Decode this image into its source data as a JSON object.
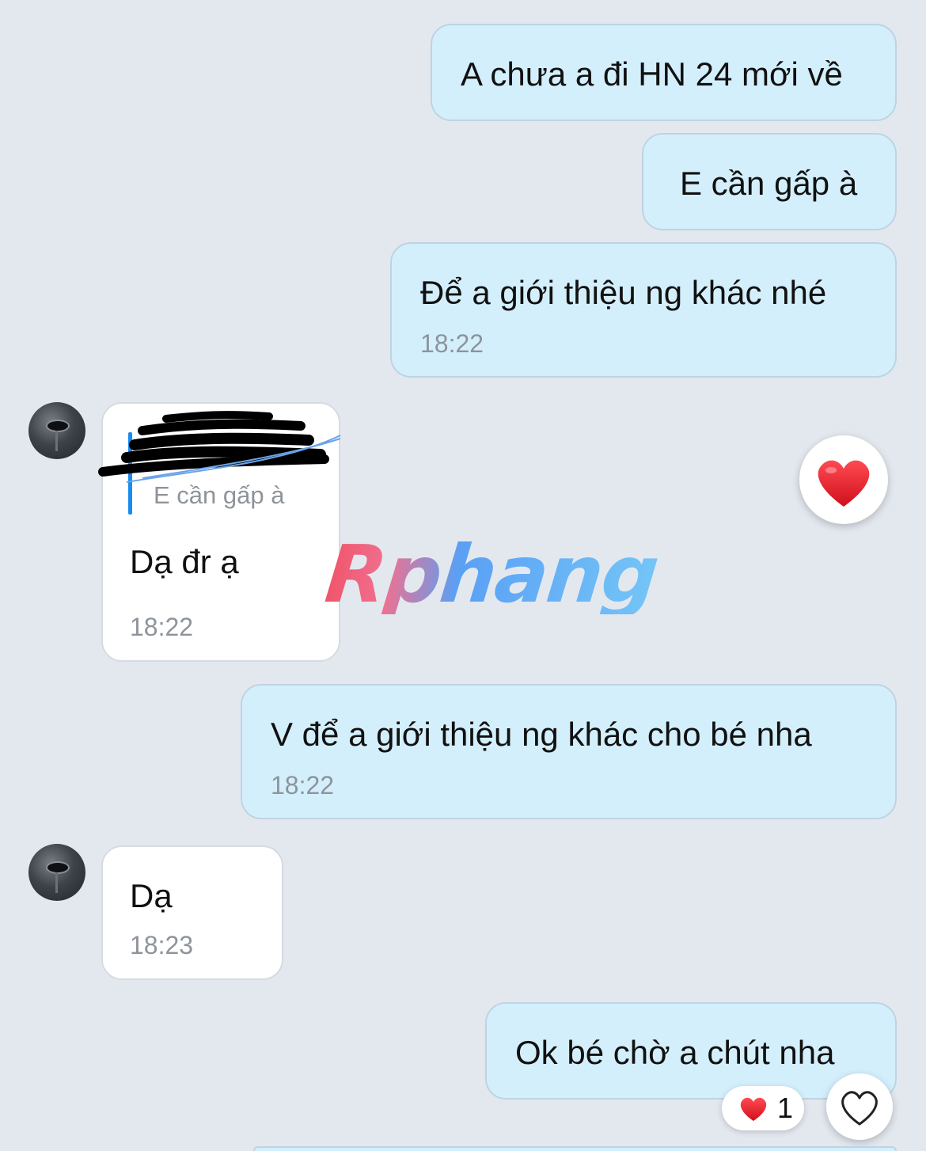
{
  "messages": [
    {
      "id": "m1",
      "side": "outgoing",
      "text": "A chưa a đi HN 24 mới về",
      "time": null
    },
    {
      "id": "m2",
      "side": "outgoing",
      "text": "E cần gấp à",
      "time": null
    },
    {
      "id": "m3",
      "side": "outgoing",
      "text": "Để a giới thiệu ng khác nhé",
      "time": "18:22"
    },
    {
      "id": "m4",
      "side": "incoming",
      "quote": "E cần gấp à",
      "text": "Dạ đr ạ",
      "time": "18:22",
      "reaction": "heart"
    },
    {
      "id": "m5",
      "side": "outgoing",
      "text": "V để a giới thiệu ng khác cho bé nha",
      "time": "18:22"
    },
    {
      "id": "m6",
      "side": "incoming",
      "text": "Dạ",
      "time": "18:23"
    },
    {
      "id": "m7",
      "side": "outgoing",
      "text": "Ok bé chờ a chút nha",
      "time": null,
      "reaction_count": "1"
    }
  ],
  "watermark": "Rphang",
  "icons": {
    "reaction": "red-heart-icon",
    "like": "heart-outline-icon",
    "avatar": "contact-avatar"
  },
  "colors": {
    "background": "#e3e8ef",
    "outgoing_bubble": "#d4effc",
    "incoming_bubble": "#ffffff",
    "time": "#8d949b",
    "quote_bar": "#1a8cf0",
    "heart": "#e8202e"
  }
}
